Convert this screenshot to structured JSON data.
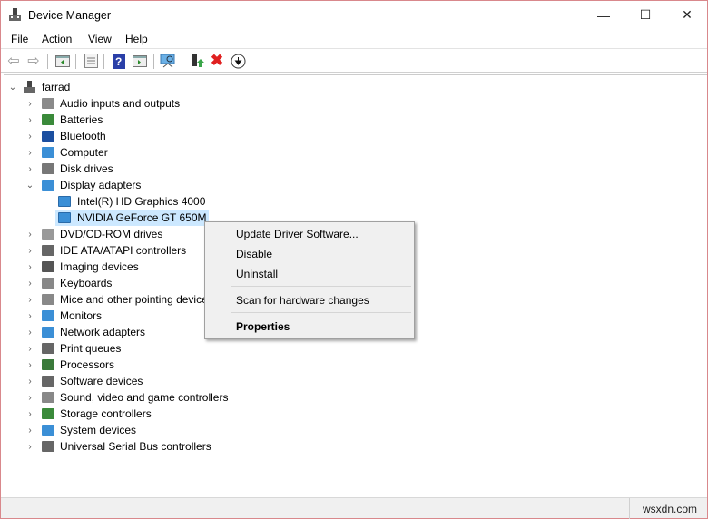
{
  "window": {
    "title": "Device Manager",
    "minimize": "—",
    "maximize": "☐",
    "close": "✕"
  },
  "menu": [
    "File",
    "Action",
    "View",
    "Help"
  ],
  "toolbar": [
    "back-icon",
    "forward-icon",
    "show-hide-console-tree-icon",
    "properties-icon",
    "help-icon",
    "action-pane-icon",
    "scan-hardware-icon",
    "update-driver-icon",
    "uninstall-icon",
    "disable-icon"
  ],
  "tree": {
    "root": "farrad",
    "categories": [
      {
        "label": "Audio inputs and outputs",
        "icon": "speaker",
        "color": "#8a8a8a"
      },
      {
        "label": "Batteries",
        "icon": "battery",
        "color": "#3a8a3a"
      },
      {
        "label": "Bluetooth",
        "icon": "bluetooth",
        "color": "#1c4fa0"
      },
      {
        "label": "Computer",
        "icon": "monitor",
        "color": "#3b8fd6"
      },
      {
        "label": "Disk drives",
        "icon": "disk",
        "color": "#777"
      },
      {
        "label": "Display adapters",
        "icon": "display",
        "color": "#3b8fd6",
        "expanded": true,
        "children": [
          "Intel(R) HD Graphics 4000",
          "NVIDIA GeForce GT 650M"
        ]
      },
      {
        "label": "DVD/CD-ROM drives",
        "icon": "dvd",
        "color": "#999"
      },
      {
        "label": "IDE ATA/ATAPI controllers",
        "icon": "ide",
        "color": "#666"
      },
      {
        "label": "Imaging devices",
        "icon": "camera",
        "color": "#555"
      },
      {
        "label": "Keyboards",
        "icon": "keyboard",
        "color": "#888"
      },
      {
        "label": "Mice and other pointing devices",
        "icon": "mouse",
        "color": "#888"
      },
      {
        "label": "Monitors",
        "icon": "monitor",
        "color": "#3b8fd6"
      },
      {
        "label": "Network adapters",
        "icon": "network",
        "color": "#3b8fd6"
      },
      {
        "label": "Print queues",
        "icon": "printer",
        "color": "#666"
      },
      {
        "label": "Processors",
        "icon": "cpu",
        "color": "#3a7a3a"
      },
      {
        "label": "Software devices",
        "icon": "software",
        "color": "#666"
      },
      {
        "label": "Sound, video and game controllers",
        "icon": "sound",
        "color": "#888"
      },
      {
        "label": "Storage controllers",
        "icon": "storage",
        "color": "#3a8a3a"
      },
      {
        "label": "System devices",
        "icon": "system",
        "color": "#3b8fd6"
      },
      {
        "label": "Universal Serial Bus controllers",
        "icon": "usb",
        "color": "#666"
      }
    ],
    "selected": "NVIDIA GeForce GT 650M"
  },
  "context_menu": [
    "Update Driver Software...",
    "Disable",
    "Uninstall",
    "Scan for hardware changes",
    "Properties"
  ],
  "status": {
    "watermark": "wsxdn.com"
  },
  "colors": {
    "selection": "#cce8ff",
    "border": "#d9888c"
  }
}
